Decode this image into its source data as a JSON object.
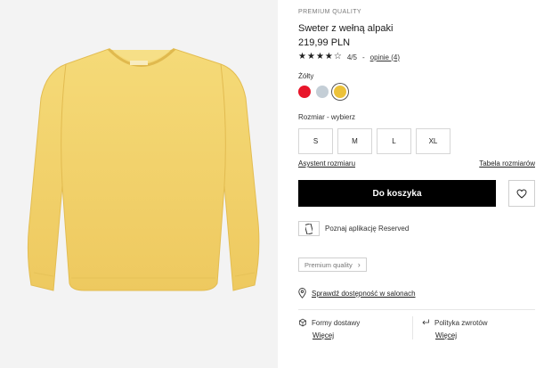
{
  "product": {
    "brand_tag": "PREMIUM QUALITY",
    "title": "Sweter z wełną alpaki",
    "price": "219,99 PLN",
    "rating": {
      "value": 4,
      "max": 5,
      "score_text": "4/5",
      "separator": "-",
      "reviews_link": "opinie (4)"
    }
  },
  "color": {
    "label": "Żółty",
    "swatches": [
      {
        "name": "red",
        "hex": "#e8152a"
      },
      {
        "name": "light-blue",
        "hex": "#c4ced6"
      },
      {
        "name": "yellow",
        "hex": "#ecc23a",
        "selected": true
      }
    ]
  },
  "size": {
    "label": "Rozmiar -  wybierz",
    "options": [
      "S",
      "M",
      "L",
      "XL"
    ],
    "assistant_link": "Asystent rozmiaru",
    "table_link": "Tabela rozmiarów"
  },
  "actions": {
    "add_to_cart": "Do koszyka",
    "wishlist_icon": "heart-icon"
  },
  "app_promo": {
    "text": "Poznaj aplikację Reserved",
    "icon": "phone-icon"
  },
  "quality_tag": {
    "label": "Premium quality",
    "icon": "chevron-right-icon"
  },
  "store": {
    "link": "Sprawdź dostępność w salonach",
    "icon": "location-pin-icon"
  },
  "shipping": {
    "delivery": {
      "label": "Formy dostawy",
      "more": "Więcej",
      "icon": "package-icon"
    },
    "returns": {
      "label": "Polityka zwrotów",
      "more": "Więcej",
      "icon": "return-arrow-icon"
    }
  },
  "colors": {
    "accent": "#000000",
    "background_image": "#f3f3f3",
    "sweater": "#f2d36b"
  }
}
